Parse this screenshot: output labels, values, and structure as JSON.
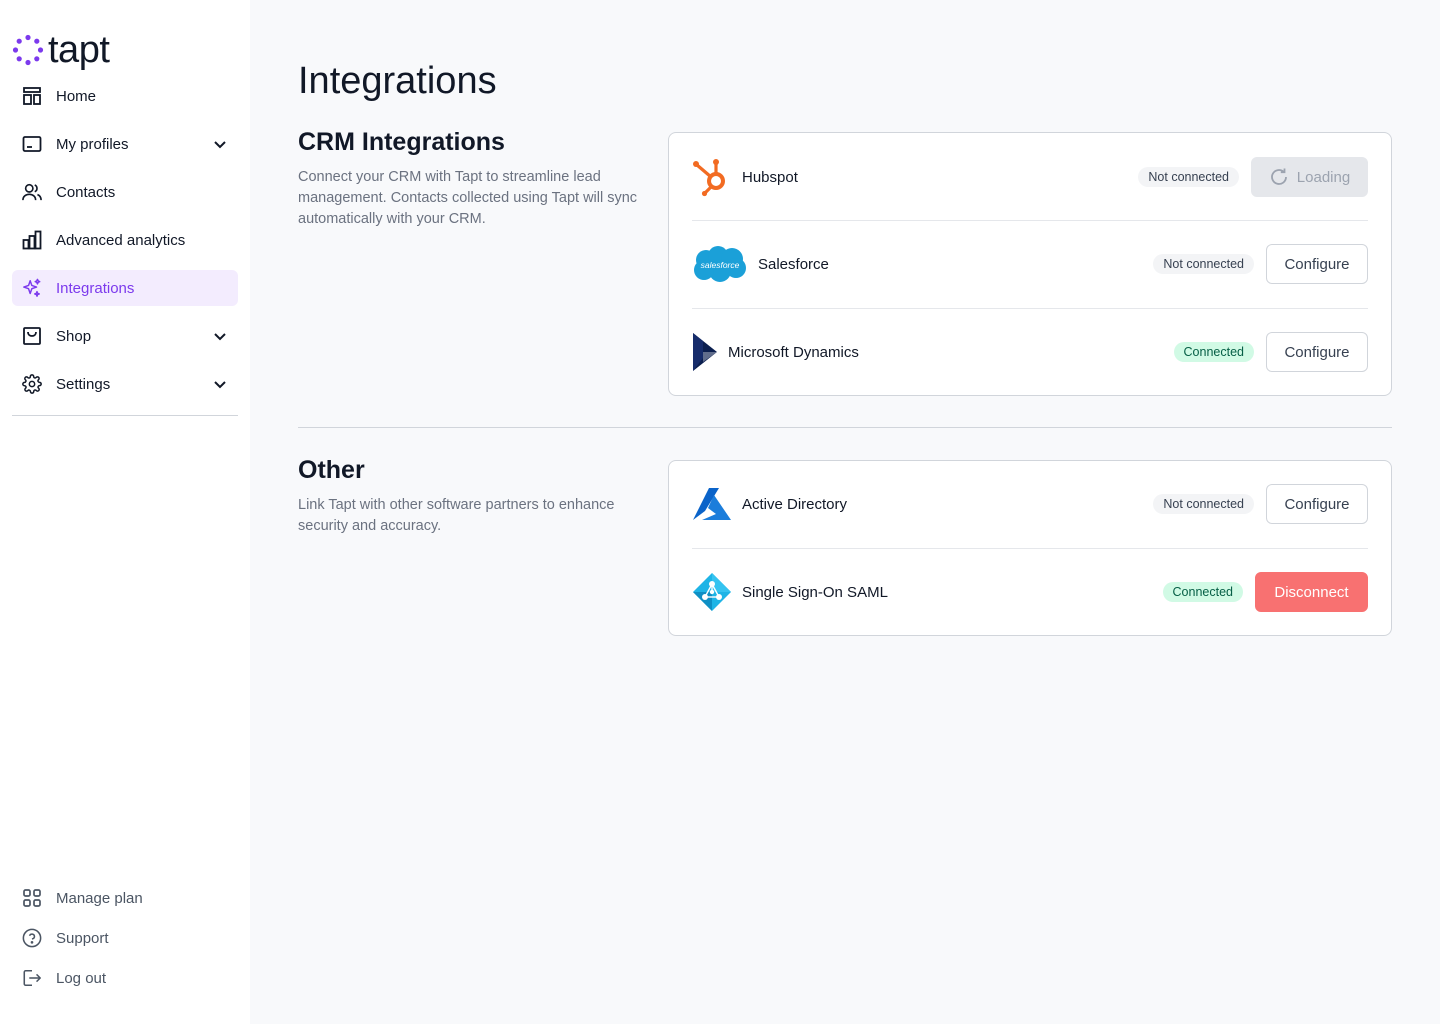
{
  "brand": {
    "name": "tapt",
    "accent": "#7c3aed"
  },
  "sidebar": {
    "items": [
      {
        "label": "Home",
        "icon": "home-icon",
        "has_chevron": false
      },
      {
        "label": "My profiles",
        "icon": "profile-card-icon",
        "has_chevron": true
      },
      {
        "label": "Contacts",
        "icon": "contacts-icon",
        "has_chevron": false
      },
      {
        "label": "Advanced analytics",
        "icon": "analytics-icon",
        "has_chevron": false
      },
      {
        "label": "Integrations",
        "icon": "sparkle-icon",
        "has_chevron": false,
        "active": true
      },
      {
        "label": "Shop",
        "icon": "shop-bag-icon",
        "has_chevron": true
      },
      {
        "label": "Settings",
        "icon": "gear-icon",
        "has_chevron": true
      }
    ],
    "bottom": [
      {
        "label": "Manage plan",
        "icon": "grid-icon"
      },
      {
        "label": "Support",
        "icon": "help-icon"
      },
      {
        "label": "Log out",
        "icon": "logout-icon"
      }
    ]
  },
  "main": {
    "title": "Integrations",
    "crm": {
      "title": "CRM Integrations",
      "description": "Connect your CRM with Tapt to streamline lead management. Contacts collected using Tapt will sync automatically with your CRM.",
      "items": [
        {
          "name": "Hubspot",
          "status": "Not connected",
          "action": "Loading",
          "logo": "hubspot-logo-icon"
        },
        {
          "name": "Salesforce",
          "status": "Not connected",
          "action": "Configure",
          "logo": "salesforce-logo-icon",
          "logo_text": "salesforce"
        },
        {
          "name": "Microsoft Dynamics",
          "status": "Connected",
          "action": "Configure",
          "logo": "microsoft-dynamics-logo-icon"
        }
      ]
    },
    "other": {
      "title": "Other",
      "description": "Link Tapt with other software partners to enhance security and accuracy.",
      "items": [
        {
          "name": "Active Directory",
          "status": "Not connected",
          "action": "Configure",
          "logo": "azure-active-directory-logo-icon"
        },
        {
          "name": "Single Sign-On SAML",
          "status": "Connected",
          "action": "Disconnect",
          "logo": "sso-saml-logo-icon"
        }
      ]
    }
  }
}
